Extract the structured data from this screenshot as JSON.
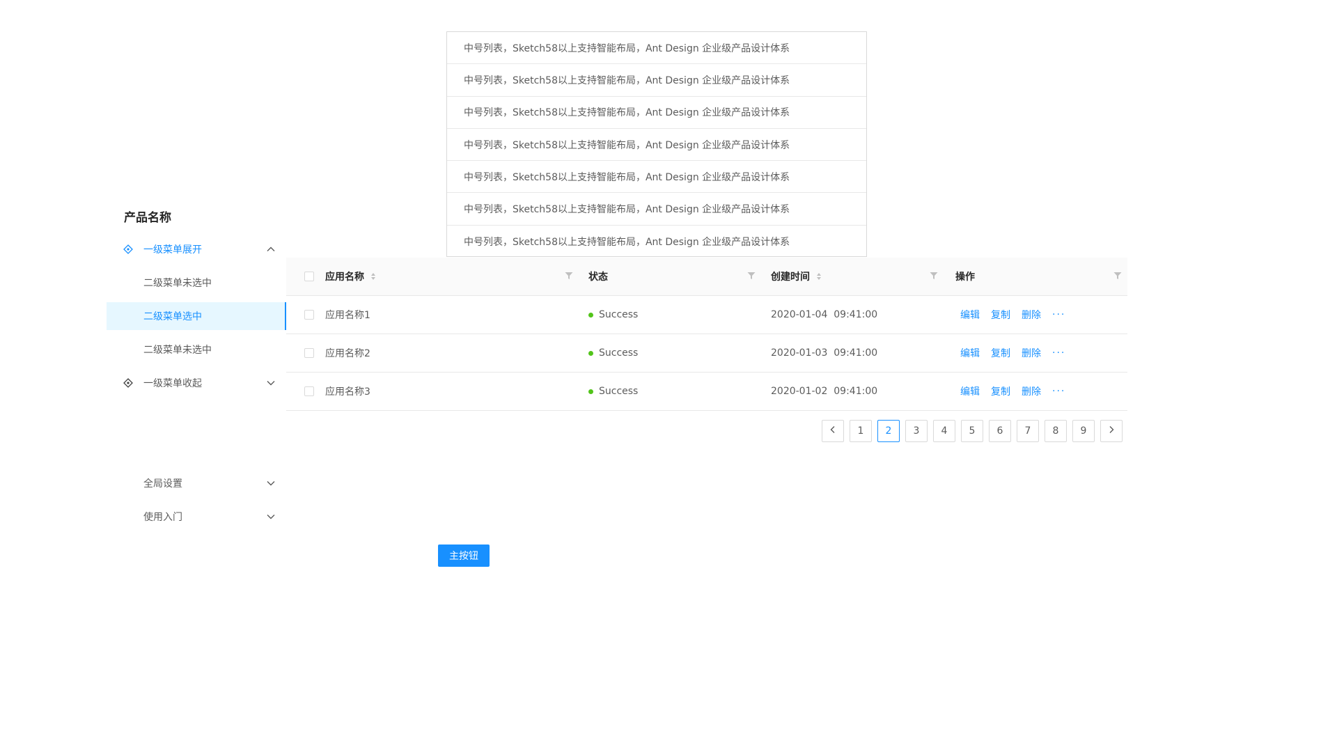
{
  "sidebar": {
    "product_name": "产品名称",
    "items": [
      {
        "label": "一级菜单展开",
        "icon": "diamond-icon",
        "arrow": "chevron-up-icon",
        "state": "expanded"
      },
      {
        "label": "二级菜单未选中",
        "state": "unselected"
      },
      {
        "label": "二级菜单选中",
        "state": "selected"
      },
      {
        "label": "二级菜单未选中",
        "state": "unselected"
      },
      {
        "label": "一级菜单收起",
        "icon": "diamond-icon",
        "arrow": "chevron-down-icon",
        "state": "collapsed"
      }
    ],
    "groups": [
      {
        "label": "全局设置",
        "arrow": "chevron-down-icon"
      },
      {
        "label": "使用入门",
        "arrow": "chevron-down-icon"
      }
    ]
  },
  "list": {
    "items": [
      "中号列表，Sketch58以上支持智能布局，Ant Design 企业级产品设计体系",
      "中号列表，Sketch58以上支持智能布局，Ant Design 企业级产品设计体系",
      "中号列表，Sketch58以上支持智能布局，Ant Design 企业级产品设计体系",
      "中号列表，Sketch58以上支持智能布局，Ant Design 企业级产品设计体系",
      "中号列表，Sketch58以上支持智能布局，Ant Design 企业级产品设计体系",
      "中号列表，Sketch58以上支持智能布局，Ant Design 企业级产品设计体系",
      "中号列表，Sketch58以上支持智能布局，Ant Design 企业级产品设计体系"
    ]
  },
  "table": {
    "columns": [
      "应用名称",
      "状态",
      "创建时间",
      "操作"
    ],
    "rows": [
      {
        "name": "应用名称1",
        "status": "Success",
        "time": "2020-01-04  09:41:00"
      },
      {
        "name": "应用名称2",
        "status": "Success",
        "time": "2020-01-03  09:41:00"
      },
      {
        "name": "应用名称3",
        "status": "Success",
        "time": "2020-01-02  09:41:00"
      }
    ],
    "actions": {
      "edit": "编辑",
      "copy": "复制",
      "delete": "删除",
      "more": "···"
    }
  },
  "pagination": {
    "pages": [
      "1",
      "2",
      "3",
      "4",
      "5",
      "6",
      "7",
      "8",
      "9"
    ],
    "current": "2"
  },
  "primary_button": {
    "label": "主按钮"
  },
  "colors": {
    "primary": "#1890ff",
    "success": "#52c41a",
    "selected_bg": "#e6f7ff",
    "border": "#d9d9d9"
  }
}
